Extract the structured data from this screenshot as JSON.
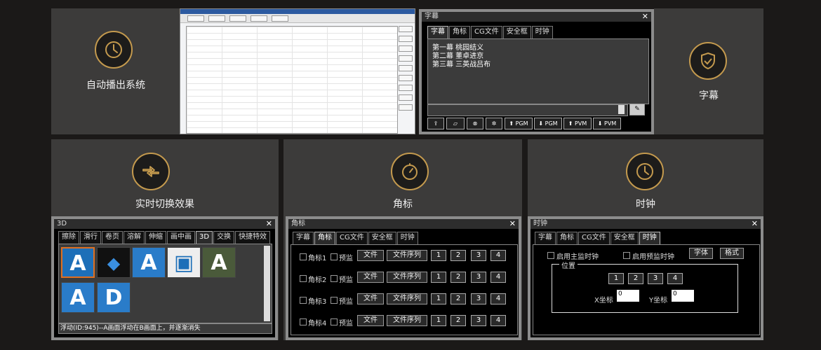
{
  "colors": {
    "accent": "#c49a4e",
    "tile": "#3c3b3a",
    "bg": "#1b1918"
  },
  "tiles": {
    "auto_play": {
      "label": "自动播出系统",
      "icon": "clock-icon"
    },
    "subtitle": {
      "label": "字幕",
      "icon": "shield-check-icon"
    },
    "realtime_switch": {
      "label": "实时切换效果",
      "icon": "arrows-exchange-icon"
    },
    "logo": {
      "label": "角标",
      "icon": "timer-icon"
    },
    "clock": {
      "label": "时钟",
      "icon": "clock-icon"
    }
  },
  "subtitle_window": {
    "title": "字幕",
    "close": "✕",
    "tabs": [
      "字幕",
      "角标",
      "CG文件",
      "安全框",
      "时钟"
    ],
    "lines": [
      "第一幕 桃园结义",
      "第二幕 董卓进京",
      "第三幕 三英战吕布"
    ],
    "toolbar": {
      "pgm_up": "PGM",
      "pgm_down": "PGM",
      "pvm_up": "PVM",
      "pvm_down": "PVM"
    }
  },
  "effect_window": {
    "title": "3D",
    "close": "✕",
    "tabs": [
      "擦除",
      "滑行",
      "卷页",
      "溶解",
      "伸缩",
      "画中画",
      "3D",
      "交换",
      "快捷特效"
    ],
    "status": "浮动(ID:945)--A画面浮动在B画面上，并逐渐消失"
  },
  "logo_window": {
    "title": "角标",
    "close": "✕",
    "tabs": [
      "字幕",
      "角标",
      "CG文件",
      "安全框",
      "时钟"
    ],
    "rows": [
      {
        "name": "角标1",
        "preview": "预监",
        "file": "文件",
        "sequence": "文件序列",
        "nums": [
          "1",
          "2",
          "3",
          "4"
        ]
      },
      {
        "name": "角标2",
        "preview": "预监",
        "file": "文件",
        "sequence": "文件序列",
        "nums": [
          "1",
          "2",
          "3",
          "4"
        ]
      },
      {
        "name": "角标3",
        "preview": "预监",
        "file": "文件",
        "sequence": "文件序列",
        "nums": [
          "1",
          "2",
          "3",
          "4"
        ]
      },
      {
        "name": "角标4",
        "preview": "预监",
        "file": "文件",
        "sequence": "文件序列",
        "nums": [
          "1",
          "2",
          "3",
          "4"
        ]
      }
    ]
  },
  "clock_window": {
    "title": "时钟",
    "close": "✕",
    "tabs": [
      "字幕",
      "角标",
      "CG文件",
      "安全框",
      "时钟"
    ],
    "main_clock": "启用主监时钟",
    "preview_clock": "启用预监时钟",
    "font_btn": "字体",
    "format_btn": "格式",
    "position_label": "位置",
    "nums": [
      "1",
      "2",
      "3",
      "4"
    ],
    "x_label": "X坐标",
    "x_value": "0",
    "y_label": "Y坐标",
    "y_value": "0"
  }
}
